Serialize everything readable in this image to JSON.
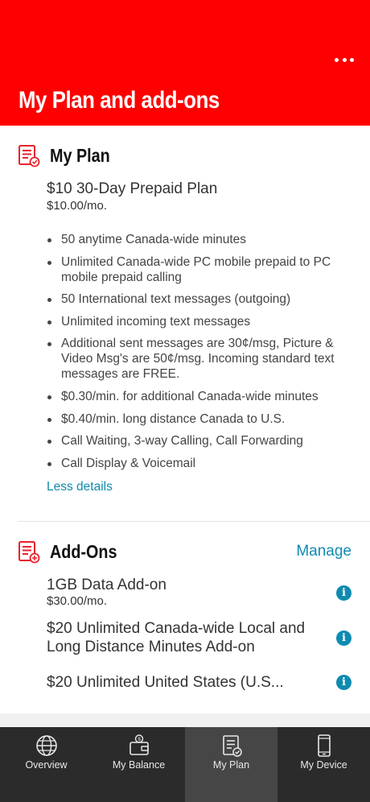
{
  "header": {
    "title": "My Plan and add-ons",
    "background_color": "#ff0000",
    "more_icon": "more-horizontal-icon"
  },
  "my_plan": {
    "section_title": "My Plan",
    "icon": "plan-document-check-icon",
    "plan_name": "$10 30-Day Prepaid Plan",
    "plan_price": "$10.00/mo.",
    "features": [
      "50 anytime Canada-wide minutes",
      "Unlimited Canada-wide PC mobile prepaid to PC mobile prepaid calling",
      "50 International text messages (outgoing)",
      "Unlimited incoming text messages",
      "Additional sent messages are 30¢/msg, Picture & Video Msg's are 50¢/msg. Incoming standard text messages are FREE.",
      "$0.30/min. for additional Canada-wide minutes",
      "$0.40/min. long distance Canada to U.S.",
      "Call Waiting, 3-way Calling, Call Forwarding",
      "Call Display & Voicemail"
    ],
    "less_details_label": "Less details"
  },
  "add_ons": {
    "section_title": "Add-Ons",
    "icon": "addon-document-plus-icon",
    "manage_label": "Manage",
    "items": [
      {
        "name": "1GB Data Add-on",
        "price": "$30.00/mo."
      },
      {
        "name": "$20 Unlimited Canada-wide Local and Long Distance Minutes Add-on",
        "price": ""
      },
      {
        "name": "$20 Unlimited United States (U.S...",
        "price": ""
      }
    ],
    "info_icon": "info-icon"
  },
  "tabbar": {
    "tabs": [
      {
        "label": "Overview",
        "icon": "globe-icon",
        "active": false
      },
      {
        "label": "My Balance",
        "icon": "wallet-icon",
        "active": false
      },
      {
        "label": "My Plan",
        "icon": "plan-document-icon",
        "active": true
      },
      {
        "label": "My Device",
        "icon": "phone-icon",
        "active": false
      }
    ]
  },
  "colors": {
    "brand_red": "#ff0000",
    "link_blue": "#0f8bb0",
    "tabbar_bg": "#2b2b2b",
    "tabbar_active_bg": "#464646"
  }
}
